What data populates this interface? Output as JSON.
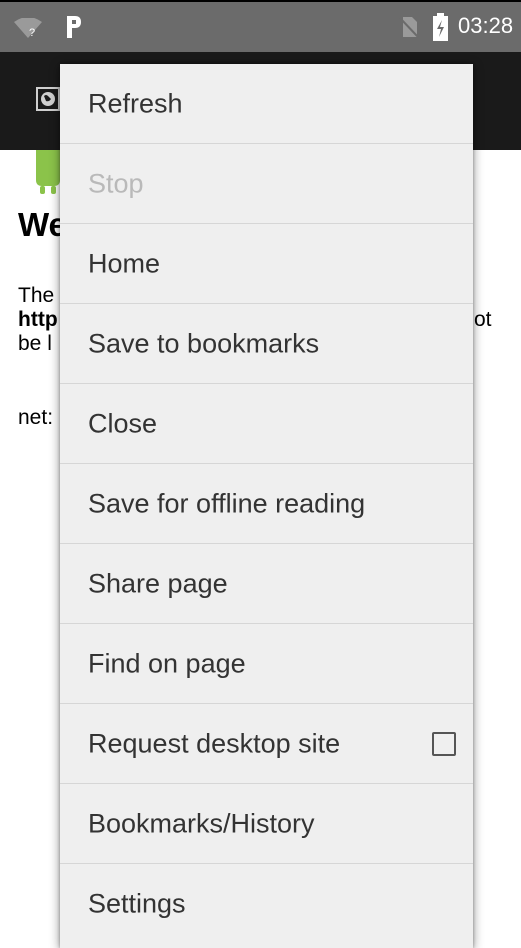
{
  "status_bar": {
    "time": "03:28",
    "icons": [
      "wifi-unknown-icon",
      "app-p-icon",
      "no-sim-icon",
      "battery-charging-icon"
    ]
  },
  "toolbar": {
    "icon": "globe-icon"
  },
  "page": {
    "heading": "We",
    "line1": "The",
    "line2_url": "http",
    "line2_trail": "ot",
    "line3": "be l",
    "error_code": "net:"
  },
  "menu": {
    "items": [
      {
        "label": "Refresh",
        "enabled": true
      },
      {
        "label": "Stop",
        "enabled": false
      },
      {
        "label": "Home",
        "enabled": true
      },
      {
        "label": "Save to bookmarks",
        "enabled": true
      },
      {
        "label": "Close",
        "enabled": true
      },
      {
        "label": "Save for offline reading",
        "enabled": true
      },
      {
        "label": "Share page",
        "enabled": true
      },
      {
        "label": "Find on page",
        "enabled": true
      },
      {
        "label": "Request desktop site",
        "enabled": true,
        "checkbox": true,
        "checked": false
      },
      {
        "label": "Bookmarks/History",
        "enabled": true
      },
      {
        "label": "Settings",
        "enabled": true
      }
    ]
  },
  "colors": {
    "status_bar": "#6b6b6b",
    "toolbar": "#1a1a1a",
    "menu_bg": "#efefef",
    "menu_text": "#333333",
    "menu_disabled_text": "#b9b9b9",
    "android_green": "#8bc34a"
  }
}
